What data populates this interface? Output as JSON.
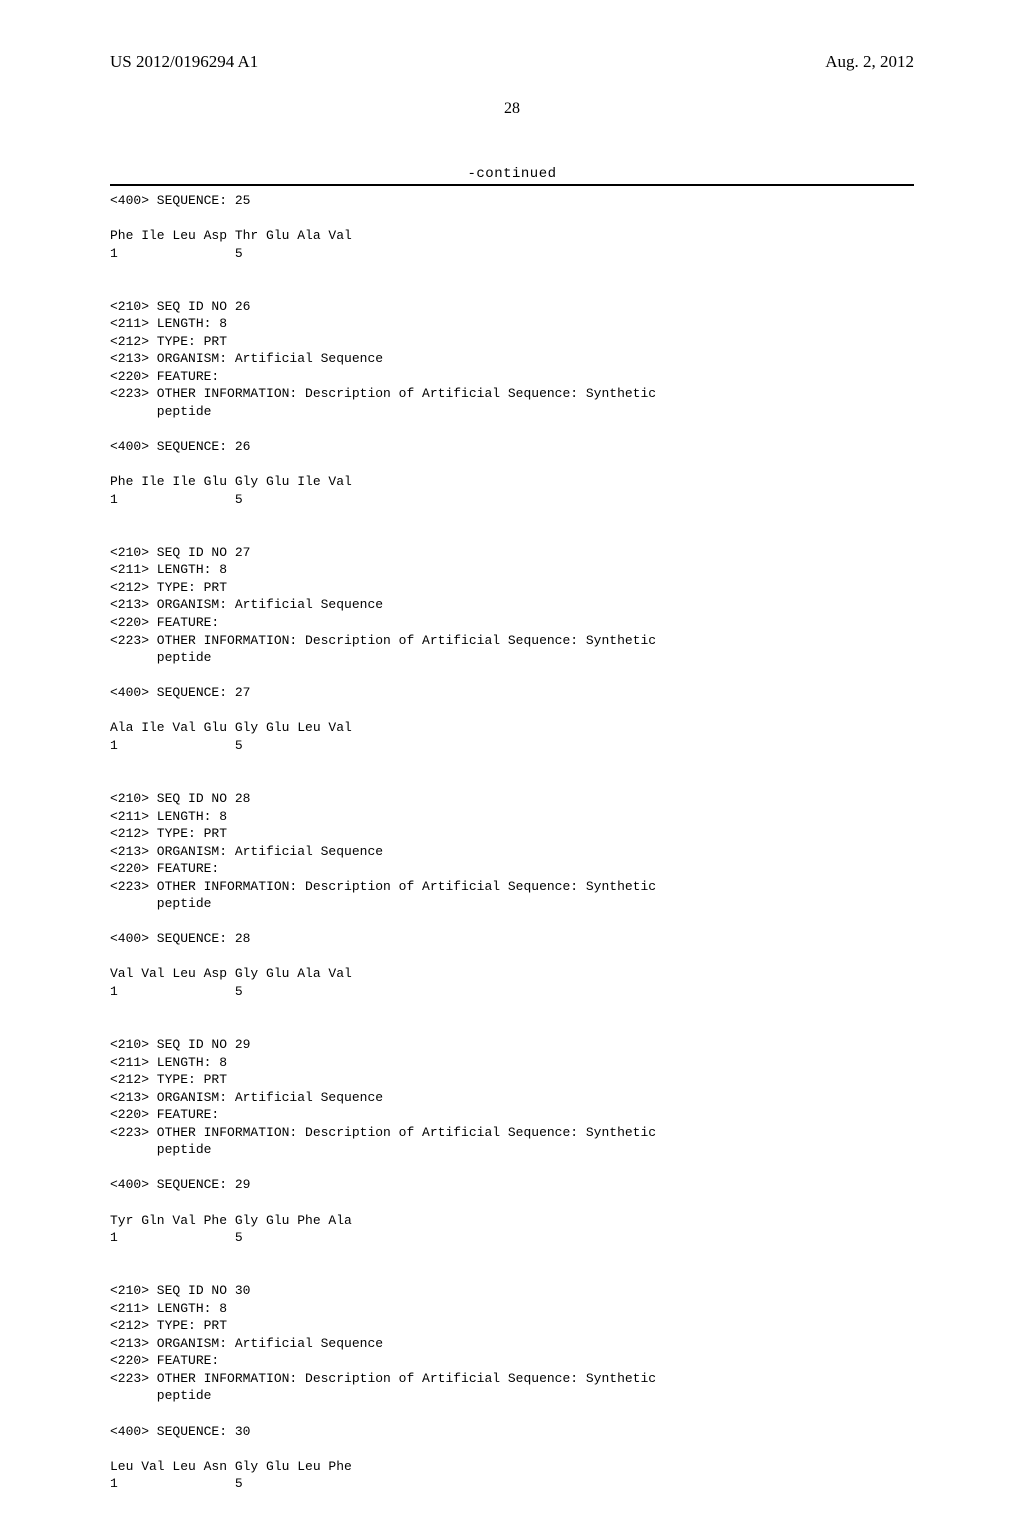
{
  "header": {
    "publication_number": "US 2012/0196294 A1",
    "publication_date": "Aug. 2, 2012"
  },
  "page_number": "28",
  "continued_label": "-continued",
  "sequences": [
    {
      "lines": [
        "<400> SEQUENCE: 25",
        "",
        "Phe Ile Leu Asp Thr Glu Ala Val",
        "1               5"
      ]
    },
    {
      "lines": [
        "<210> SEQ ID NO 26",
        "<211> LENGTH: 8",
        "<212> TYPE: PRT",
        "<213> ORGANISM: Artificial Sequence",
        "<220> FEATURE:",
        "<223> OTHER INFORMATION: Description of Artificial Sequence: Synthetic",
        "      peptide",
        "",
        "<400> SEQUENCE: 26",
        "",
        "Phe Ile Ile Glu Gly Glu Ile Val",
        "1               5"
      ]
    },
    {
      "lines": [
        "<210> SEQ ID NO 27",
        "<211> LENGTH: 8",
        "<212> TYPE: PRT",
        "<213> ORGANISM: Artificial Sequence",
        "<220> FEATURE:",
        "<223> OTHER INFORMATION: Description of Artificial Sequence: Synthetic",
        "      peptide",
        "",
        "<400> SEQUENCE: 27",
        "",
        "Ala Ile Val Glu Gly Glu Leu Val",
        "1               5"
      ]
    },
    {
      "lines": [
        "<210> SEQ ID NO 28",
        "<211> LENGTH: 8",
        "<212> TYPE: PRT",
        "<213> ORGANISM: Artificial Sequence",
        "<220> FEATURE:",
        "<223> OTHER INFORMATION: Description of Artificial Sequence: Synthetic",
        "      peptide",
        "",
        "<400> SEQUENCE: 28",
        "",
        "Val Val Leu Asp Gly Glu Ala Val",
        "1               5"
      ]
    },
    {
      "lines": [
        "<210> SEQ ID NO 29",
        "<211> LENGTH: 8",
        "<212> TYPE: PRT",
        "<213> ORGANISM: Artificial Sequence",
        "<220> FEATURE:",
        "<223> OTHER INFORMATION: Description of Artificial Sequence: Synthetic",
        "      peptide",
        "",
        "<400> SEQUENCE: 29",
        "",
        "Tyr Gln Val Phe Gly Glu Phe Ala",
        "1               5"
      ]
    },
    {
      "lines": [
        "<210> SEQ ID NO 30",
        "<211> LENGTH: 8",
        "<212> TYPE: PRT",
        "<213> ORGANISM: Artificial Sequence",
        "<220> FEATURE:",
        "<223> OTHER INFORMATION: Description of Artificial Sequence: Synthetic",
        "      peptide",
        "",
        "<400> SEQUENCE: 30",
        "",
        "Leu Val Leu Asn Gly Glu Leu Phe",
        "1               5"
      ]
    }
  ]
}
